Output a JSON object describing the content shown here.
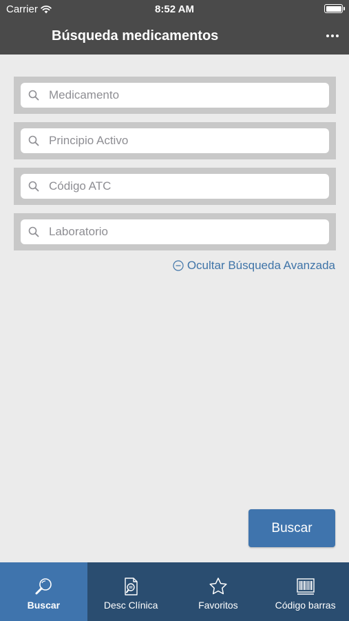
{
  "status_bar": {
    "carrier": "Carrier",
    "time": "8:52 AM",
    "battery_level": 1.0
  },
  "nav_bar": {
    "title": "Búsqueda medicamentos",
    "more_icon": "ellipsis-icon"
  },
  "search_fields": [
    {
      "placeholder": "Medicamento",
      "icon": "search-icon"
    },
    {
      "placeholder": "Principio Activo",
      "icon": "search-icon"
    },
    {
      "placeholder": "Código ATC",
      "icon": "search-icon"
    },
    {
      "placeholder": "Laboratorio",
      "icon": "search-icon"
    }
  ],
  "advanced_toggle": {
    "label": "Ocultar Búsqueda Avanzada",
    "icon": "minus-circle-icon"
  },
  "search_button": {
    "label": "Buscar"
  },
  "tab_bar": {
    "tabs": [
      {
        "label": "Buscar",
        "icon": "magnifier-icon",
        "active": true
      },
      {
        "label": "Desc Clínica",
        "icon": "clinical-document-icon",
        "active": false
      },
      {
        "label": "Favoritos",
        "icon": "star-icon",
        "active": false
      },
      {
        "label": "Código barras",
        "icon": "barcode-icon",
        "active": false
      }
    ]
  },
  "colors": {
    "nav_background": "#4a4a4a",
    "content_background": "#ebebeb",
    "field_frame": "#c8c8c8",
    "accent_blue": "#3f74ad",
    "tab_bar_background": "#2a4d70"
  }
}
